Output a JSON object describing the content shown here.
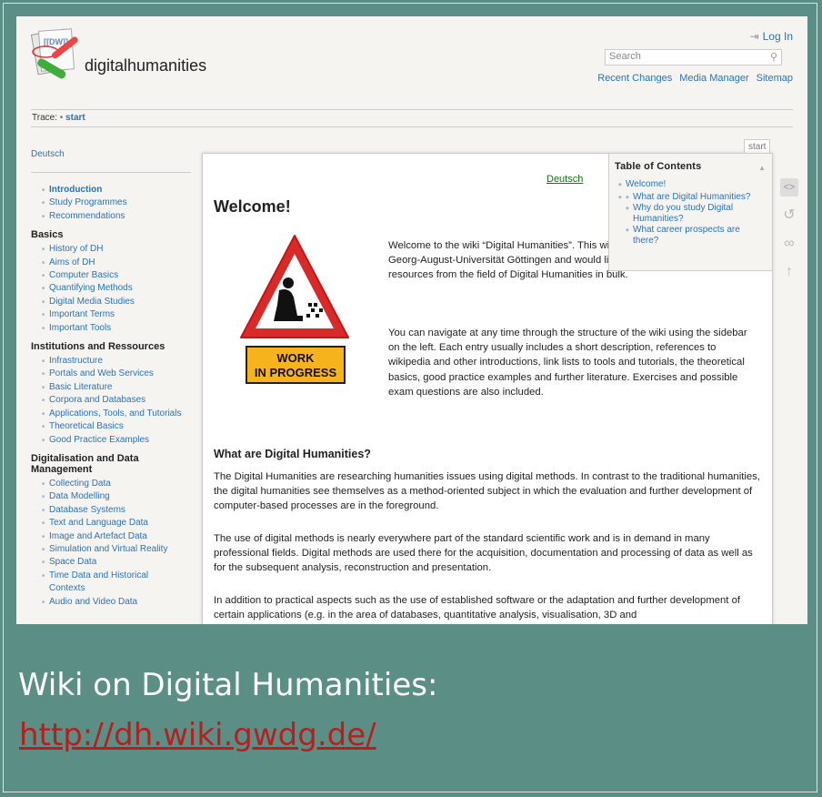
{
  "header": {
    "site_title": "digitalhumanities",
    "login": "Log In",
    "search_placeholder": "Search",
    "links": [
      "Recent Changes",
      "Media Manager",
      "Sitemap"
    ],
    "trace_label": "Trace:",
    "trace_sep": "•",
    "trace_item": "start"
  },
  "sidebar": {
    "lang_link": "Deutsch",
    "intro_items": [
      "Introduction",
      "Study Programmes",
      "Recommendations"
    ],
    "sections": [
      {
        "title": "Basics",
        "items": [
          "History of DH",
          "Aims of DH",
          "Computer Basics",
          "Quantifying Methods",
          "Digital Media Studies",
          "Important Terms",
          "Important Tools"
        ]
      },
      {
        "title": "Institutions and Ressources",
        "items": [
          "Infrastructure",
          "Portals and Web Services",
          "Basic Literature",
          "Corpora and Databases",
          "Applications, Tools, and Tutorials",
          "Theoretical Basics",
          "Good Practice Examples"
        ]
      },
      {
        "title": "Digitalisation and Data Management",
        "items": [
          "Collecting Data",
          "Data Modelling",
          "Database Systems",
          "Text and Language Data",
          "Image and Artefact Data",
          "Simulation and Virtual Reality",
          "Space Data",
          "Time Data and Historical Contexts",
          "Audio and Video Data"
        ]
      }
    ]
  },
  "page": {
    "tab_label": "start",
    "lang_link": "Deutsch",
    "title": "Welcome!",
    "wip_label_1": "WORK",
    "wip_label_2": "IN PROGRESS",
    "intro1": "Welcome to the wiki “Digital Humanities”. This wiki is aimed at students of the Georg-August-Universität Göttingen and would like to publish literature, tools and resources from the field of Digital Humanities in bulk.",
    "intro2": "You can navigate at any time through the structure of the wiki using the sidebar on the left. Each entry usually includes a short description, references to wikipedia and other introductions, link lists to tools and tutorials, the theoretical basics, good practice examples and further literature. Exercises and possible exam questions are also included.",
    "section_title": "What are Digital Humanities?",
    "para1": "The Digital Humanities are researching humanities issues using digital methods. In contrast to the traditional humanities, the digital humanities see themselves as a method-oriented subject in which the evaluation and further development of computer-based processes are in the foreground.",
    "para2": "The use of digital methods is nearly everywhere part of the standard scientific work and is in demand in many professional fields. Digital methods are used there for the acquisition, documentation and processing of data as well as for the subsequent analysis, reconstruction and presentation.",
    "para3": "In addition to practical aspects such as the use of established software or the adaptation and further development of certain applications (e.g. in the area of databases, quantitative analysis, visualisation, 3D and"
  },
  "toc": {
    "title": "Table of Contents",
    "top": "Welcome!",
    "items": [
      "What are Digital Humanities?",
      "Why do you study Digital Humanities?",
      "What career prospects are there?"
    ]
  },
  "caption": {
    "title": "Wiki on Digital Humanities:",
    "url": "http://dh.wiki.gwdg.de/"
  }
}
